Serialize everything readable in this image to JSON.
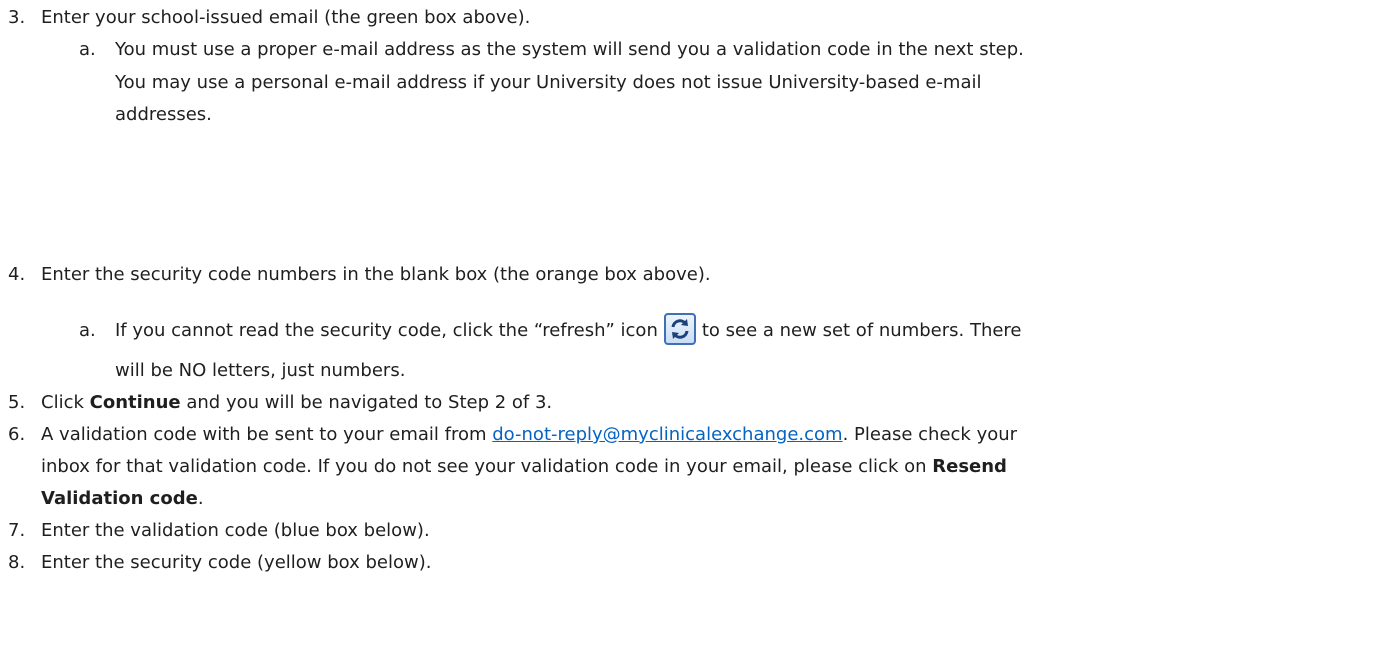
{
  "items": {
    "step3": {
      "num": "3.",
      "text": "Enter your school-issued email (the green box above).",
      "sub_a": {
        "letter": "a.",
        "line1": "You must use a proper e-mail address as the system will send you a validation code in the next step.",
        "line2": "You may use a personal e-mail address if your University does not issue University-based e-mail",
        "line3": "addresses."
      }
    },
    "step4": {
      "num": "4.",
      "text": "Enter the security code numbers in the blank box (the orange box above).",
      "sub_a": {
        "letter": "a.",
        "line1_before": "If you cannot read the security code, click the “refresh” icon",
        "line1_after": "to see a new set of numbers.  There",
        "line2": "will be NO letters, just numbers.",
        "icon": "refresh-icon"
      }
    },
    "step5": {
      "num": "5.",
      "before": "Click ",
      "bold": "Continue",
      "after": " and you will be navigated to Step 2 of 3."
    },
    "step6": {
      "num": "6.",
      "line1_before": "A validation code with be sent to your email from ",
      "link": "do-not-reply@myclinicalexchange.com",
      "line1_after": ".  Please check your",
      "line2_before": "inbox for that validation code.  If you do not see your validation code in your email, please click on ",
      "line2_bold": "Resend",
      "line3_bold": "Validation code",
      "line3_after": "."
    },
    "step7": {
      "num": "7.",
      "text": "Enter the validation code (blue box below)."
    },
    "step8": {
      "num": "8.",
      "text": "Enter the security code (yellow box below)."
    }
  },
  "colors": {
    "text": "#1f1f1f",
    "link": "#0563c1",
    "icon_border": "#3f6fb5",
    "icon_fill": "#dbe8f7"
  }
}
